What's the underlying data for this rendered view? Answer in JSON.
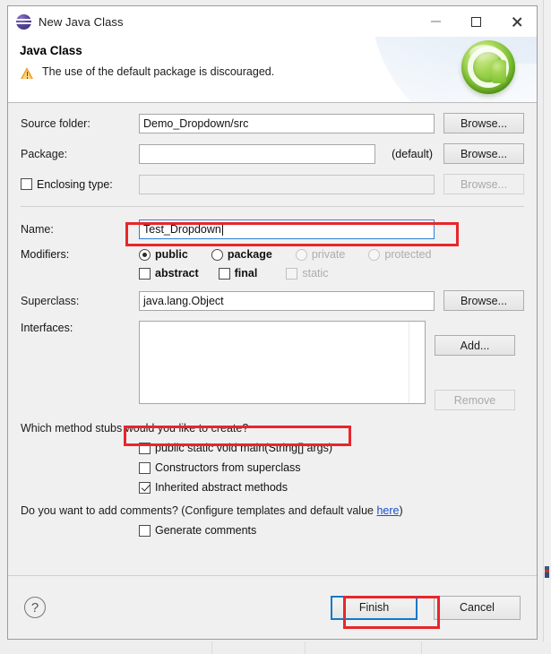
{
  "window": {
    "title": "New Java Class",
    "app_icon": "eclipse-sphere-icon",
    "minimize_label": "Minimize",
    "maximize_label": "Maximize",
    "close_label": "Close"
  },
  "banner": {
    "title": "Java Class",
    "message": "The use of the default package is discouraged.",
    "message_icon": "warning-triangle-icon",
    "logo_icon": "java-class-green-c-icon",
    "logo_letter": "C"
  },
  "form": {
    "source_folder": {
      "label": "Source folder:",
      "value": "Demo_Dropdown/src",
      "browse_label": "Browse..."
    },
    "package": {
      "label": "Package:",
      "value": "",
      "suffix": "(default)",
      "browse_label": "Browse..."
    },
    "enclosing_type": {
      "label": "Enclosing type:",
      "checked": false,
      "value": "",
      "browse_label": "Browse...",
      "disabled": true
    },
    "name": {
      "label": "Name:",
      "value": "Test_Dropdown",
      "focused": true,
      "highlighted": true
    },
    "modifiers": {
      "label": "Modifiers:",
      "access": [
        {
          "label": "public",
          "selected": true,
          "disabled": false
        },
        {
          "label": "package",
          "selected": false,
          "disabled": false
        },
        {
          "label": "private",
          "selected": false,
          "disabled": true
        },
        {
          "label": "protected",
          "selected": false,
          "disabled": true
        }
      ],
      "flags": [
        {
          "label": "abstract",
          "checked": false,
          "disabled": false
        },
        {
          "label": "final",
          "checked": false,
          "disabled": false
        },
        {
          "label": "static",
          "checked": false,
          "disabled": true
        }
      ]
    },
    "superclass": {
      "label": "Superclass:",
      "value": "java.lang.Object",
      "browse_label": "Browse..."
    },
    "interfaces": {
      "label": "Interfaces:",
      "items": [],
      "add_label": "Add...",
      "remove_label": "Remove",
      "remove_disabled": true
    }
  },
  "stubs": {
    "question": "Which method stubs would you like to create?",
    "options": [
      {
        "label": "public static void main(String[] args)",
        "checked": false,
        "highlighted": true
      },
      {
        "label": "Constructors from superclass",
        "checked": false,
        "highlighted": false
      },
      {
        "label": "Inherited abstract methods",
        "checked": true,
        "highlighted": false
      }
    ]
  },
  "comments": {
    "question_prefix": "Do you want to add comments? (Configure templates and default value ",
    "link_label": "here",
    "question_suffix": ")",
    "generate": {
      "label": "Generate comments",
      "checked": false
    }
  },
  "footer": {
    "help_label": "?",
    "finish_label": "Finish",
    "cancel_label": "Cancel",
    "finish_focused": true,
    "finish_highlighted": true
  },
  "annotations": {
    "color": "#e8262b",
    "boxes": [
      "name-field",
      "main-method-checkbox",
      "finish-button"
    ]
  }
}
